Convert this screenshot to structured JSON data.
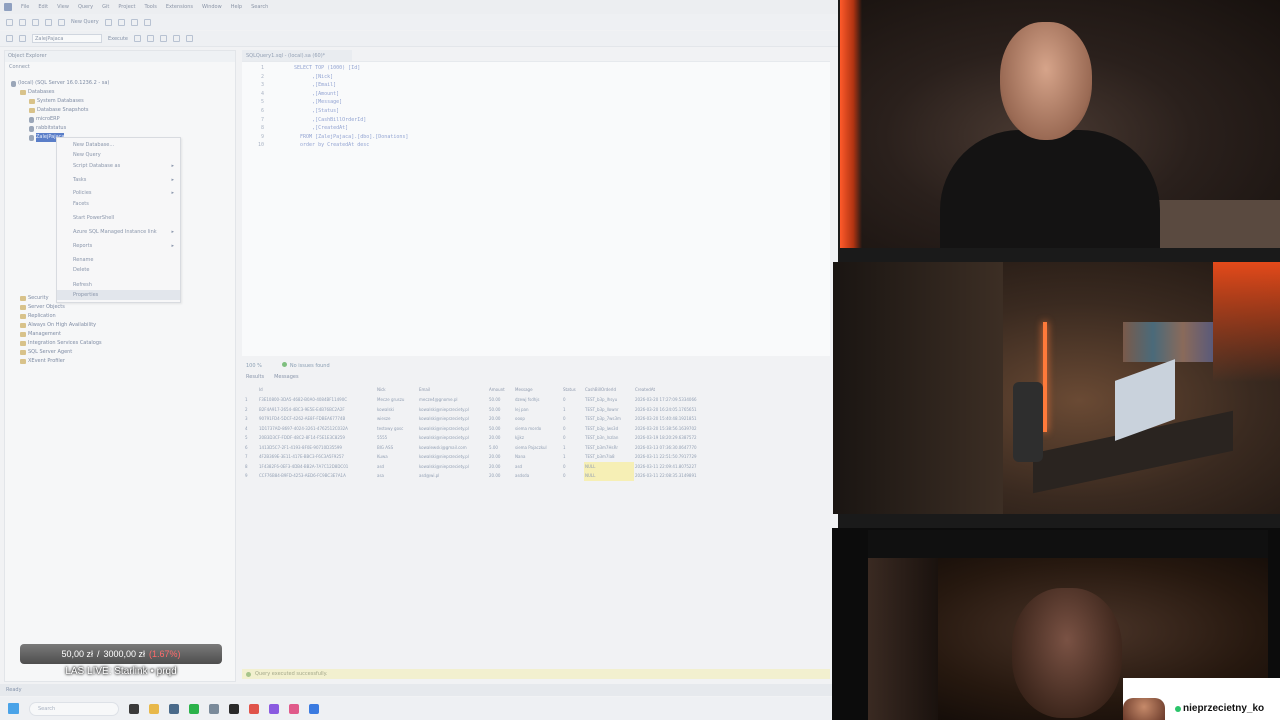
{
  "ide": {
    "menu": [
      "File",
      "Edit",
      "View",
      "Query",
      "Git",
      "Project",
      "Tools",
      "Extensions",
      "Window",
      "Help",
      "Search"
    ],
    "toolbar": {
      "new_query": "New Query",
      "database": "ZalejPajaca",
      "execute": "Execute"
    },
    "explorer": {
      "title": "Object Explorer",
      "connect": "Connect",
      "tree": [
        {
          "label": "(local) (SQL Server 16.0.1236.2 - sa)",
          "indent": 0,
          "icon": "server"
        },
        {
          "label": "Databases",
          "indent": 1,
          "icon": "folder"
        },
        {
          "label": "System Databases",
          "indent": 2,
          "icon": "folder"
        },
        {
          "label": "Database Snapshots",
          "indent": 2,
          "icon": "folder"
        },
        {
          "label": "microERP",
          "indent": 2,
          "icon": "db"
        },
        {
          "label": "rabbitstatus",
          "indent": 2,
          "icon": "db"
        },
        {
          "label": "ZalejPajaca",
          "indent": 2,
          "icon": "db"
        }
      ],
      "tree_bottom": [
        {
          "label": "Security",
          "indent": 1
        },
        {
          "label": "Server Objects",
          "indent": 1
        },
        {
          "label": "Replication",
          "indent": 1
        },
        {
          "label": "Always On High Availability",
          "indent": 1
        },
        {
          "label": "Management",
          "indent": 1
        },
        {
          "label": "Integration Services Catalogs",
          "indent": 1
        },
        {
          "label": "SQL Server Agent",
          "indent": 1
        },
        {
          "label": "XEvent Profiler",
          "indent": 1
        }
      ]
    },
    "context_menu": [
      {
        "label": "New Database...",
        "sub": false
      },
      {
        "label": "New Query",
        "sub": false
      },
      {
        "label": "Script Database as",
        "sub": true
      },
      {
        "label": "Tasks",
        "sub": true
      },
      {
        "label": "Policies",
        "sub": true
      },
      {
        "label": "Facets",
        "sub": false
      },
      {
        "label": "Start PowerShell",
        "sub": false
      },
      {
        "label": "Azure SQL Managed Instance link",
        "sub": true
      },
      {
        "label": "Reports",
        "sub": true
      },
      {
        "label": "Rename",
        "sub": false
      },
      {
        "label": "Delete",
        "sub": false
      },
      {
        "label": "Refresh",
        "sub": false
      },
      {
        "label": "Properties",
        "sub": false
      }
    ],
    "editor": {
      "tab": "SQLQuery1.sql - (local).sa (60)*",
      "lines": [
        "SELECT TOP (1000) [Id]",
        "      ,[Nick]",
        "      ,[Email]",
        "      ,[Amount]",
        "      ,[Message]",
        "      ,[Status]",
        "      ,[CashBillOrderId]",
        "      ,[CreatedAt]",
        "  FROM [ZalejPajaca].[dbo].[Donations]",
        "  order by CreatedAt desc"
      ]
    },
    "zoom": "100 %",
    "issues": "No issues found",
    "result_tabs": [
      "Results",
      "Messages"
    ],
    "grid": {
      "columns": [
        "",
        "Id",
        "Nick",
        "Email",
        "Amount",
        "Message",
        "Status",
        "CashBillOrderId",
        "CreatedAt"
      ],
      "rows": [
        [
          "1",
          "F3E10800-3DA5-4682-B0A0-4084BF11490C",
          "Mecze gruszu",
          "mecze4@gnome.pl",
          "50.00",
          "dzewj fsdhjs",
          "0",
          "TEST_b3p_lhsyu",
          "2026-03-20 17:27:09.5334066"
        ],
        [
          "2",
          "B2F4A917-2654-4BC3-9E5E-E4B76BC2A2F",
          "kowalski",
          "kowalski@nieprzeciety.pl",
          "50.00",
          "lej pan",
          "1",
          "TEST_b3p_llownr",
          "2026-03-20 16:24:05.1765651"
        ],
        [
          "3",
          "90791FD4-5DCF-4262-AE8F-FDBEA67774B",
          "wiesze",
          "kowalski@nieprzeciety.pl",
          "20.00",
          "ooop",
          "0",
          "TEST_b3p_7ws3m",
          "2026-03-20 15:40:48.1921851"
        ],
        [
          "4",
          "1D1737AD-8697-4024-3261-4762512C032A",
          "testowy gosc",
          "kowalski@nieprzeciety.pl",
          "50.00",
          "siema mordo",
          "0",
          "TEST_b3p_lws3d",
          "2026-03-20 15:38:56.1639702"
        ],
        [
          "5",
          "20B3D3CF-FDDF-48C2-8F14-F5E1E3C8259",
          "5555",
          "kowalski@nieprzeciety.pl",
          "20.00",
          "kjjkz",
          "0",
          "TEST_b3n_lnzlan",
          "2026-03-19 18:20:29.6387572"
        ],
        [
          "6",
          "1413D5C7-2F1-4193-8F0E-90710D35599",
          "BIG ASS",
          "kowalewski@gmail.com",
          "5.00",
          "siema Pajaczkul",
          "1",
          "TEST_b3m7HsRr",
          "2026-03-13 07:36:30.0647770"
        ],
        [
          "7",
          "4F2B369E-3E11-417E-BBC3-F6C3A5F9257",
          "Kuwa",
          "kowalski@nieprzeciety.pl",
          "20.00",
          "Nana",
          "1",
          "TEST_b3m7la8",
          "2026-03-11 22:51:50.7917729"
        ],
        [
          "8",
          "1F4382F6-0EF3-4DB4-BB2A-7A7C12D8DC01",
          "asd",
          "kowalski@nieprzeciety.pl",
          "20.00",
          "asd",
          "0",
          "NULL",
          "2026-03-11 22:09:41.8075227"
        ],
        [
          "9",
          "CCF76B84-B9FD-4253-AED6-FC9BC3E7A1A",
          "asa",
          "asd@wi.pl",
          "20.00",
          "asdsda",
          "0",
          "NULL",
          "2026-03-11 22:08:35.3149891"
        ]
      ]
    },
    "query_status": "Query executed successfully.",
    "status": "Ready",
    "taskbar_search": "Search"
  },
  "overlay": {
    "donation": {
      "current": "50,00 zł",
      "sep": "/",
      "goal": "3000,00 zł",
      "pct": "(1.67%)"
    },
    "live_label": "LAS LIVE: Starlink • prqd"
  },
  "badge": {
    "name": "nieprzecietny_ko"
  },
  "colors": {
    "accent": "#4aa3e8",
    "online": "#2bc46a",
    "pct_red": "#ff6a6a"
  }
}
